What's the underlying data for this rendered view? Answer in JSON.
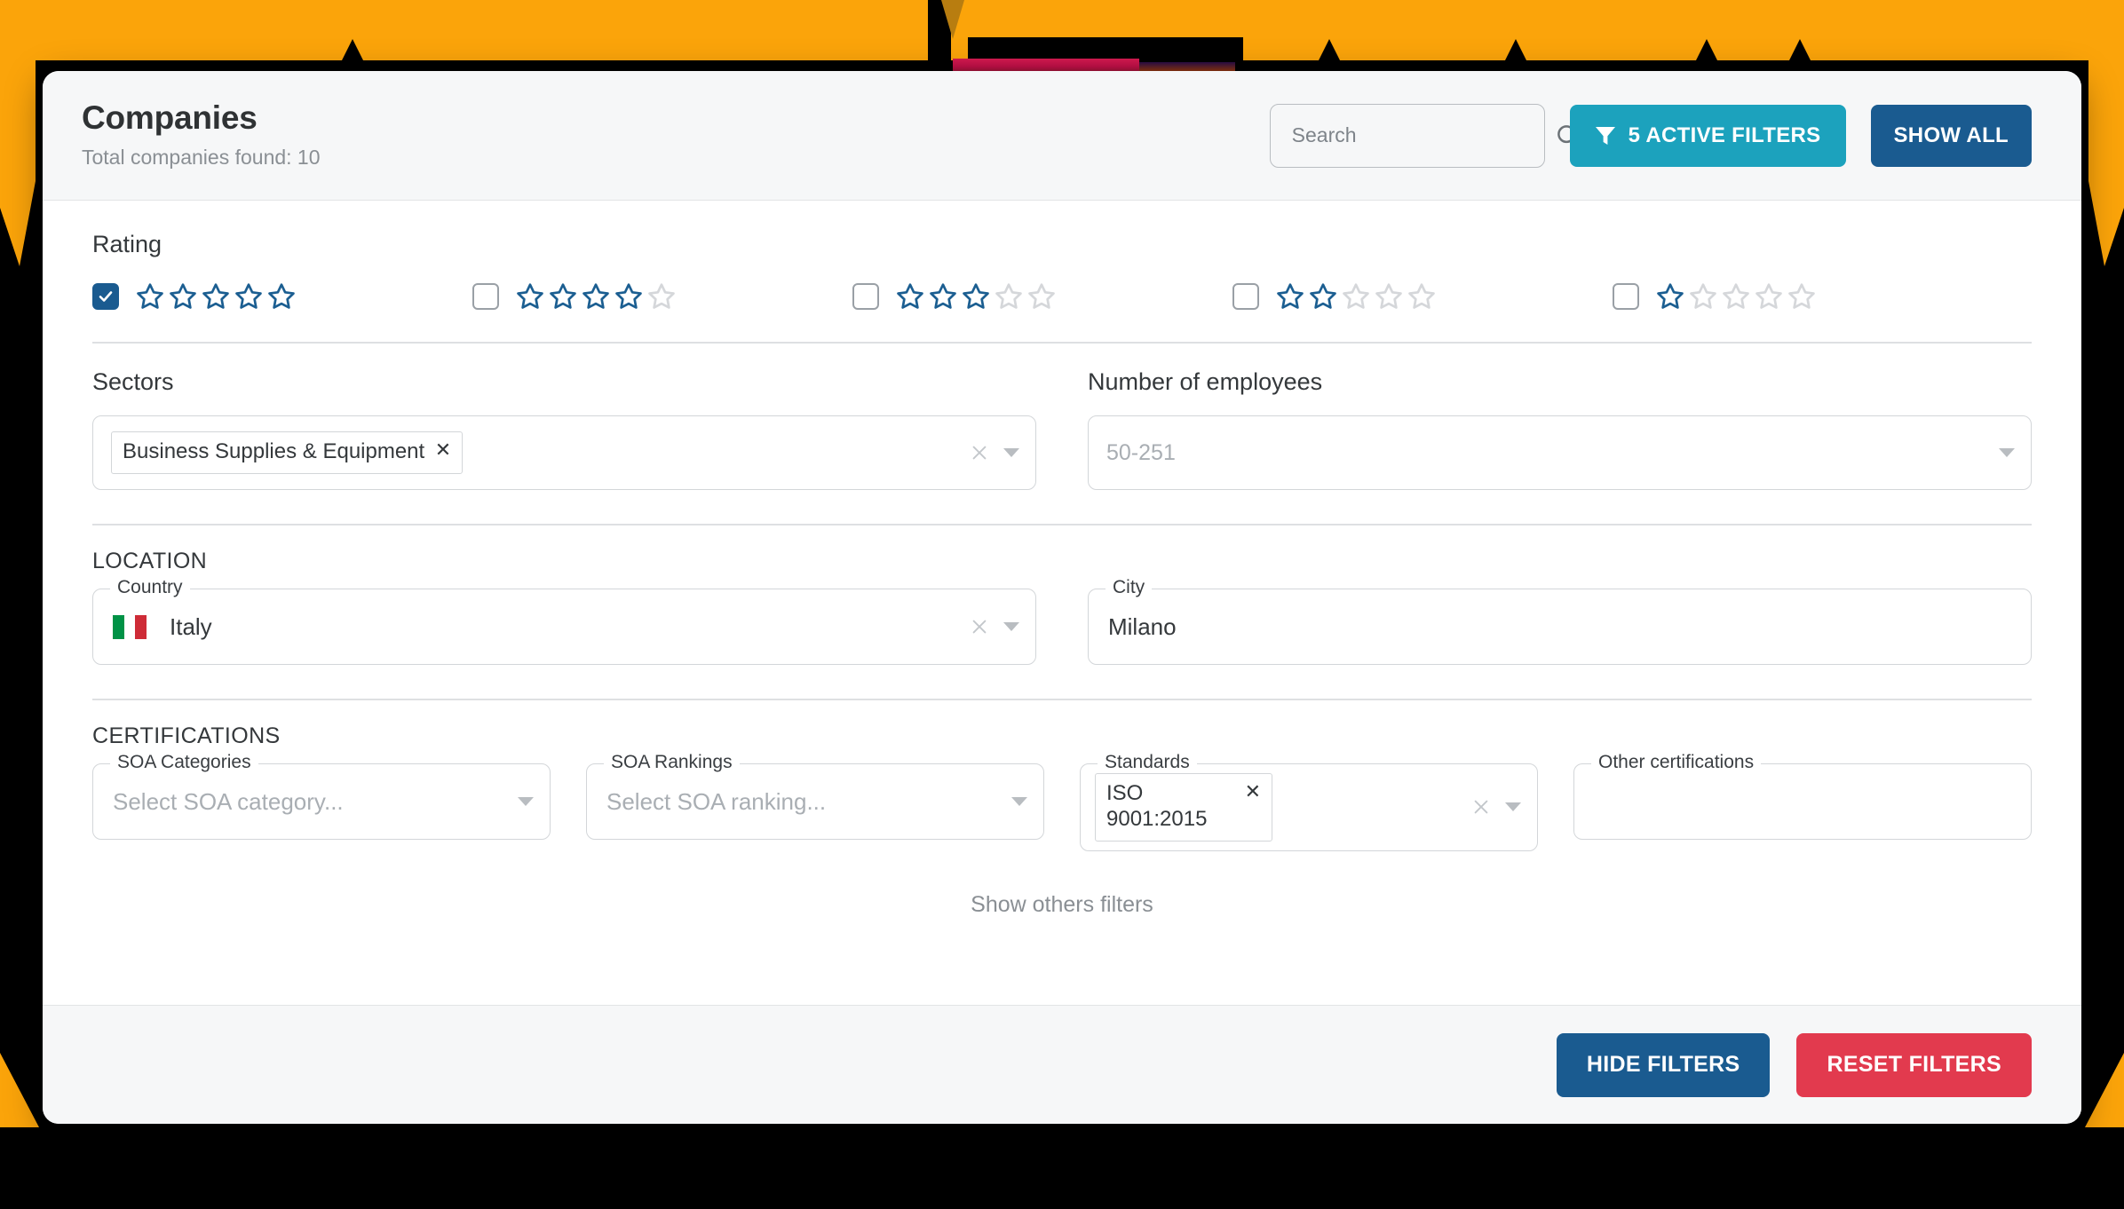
{
  "header": {
    "title": "Companies",
    "subtitle": "Total companies found: 10",
    "search": {
      "placeholder": "Search",
      "value": "",
      "icon": "search-icon"
    },
    "active_filters_button": {
      "label": "5 ACTIVE FILTERS",
      "icon": "funnel-icon",
      "color": "#1CA2BD"
    },
    "show_all_button": {
      "label": "SHOW ALL",
      "color": "#1A5B90"
    }
  },
  "rating": {
    "label": "Rating",
    "star_on_color": "#1B5E91",
    "star_off_color": "#D5D7DA",
    "options": [
      {
        "stars_filled": 5,
        "stars_total": 5,
        "checked": true
      },
      {
        "stars_filled": 4,
        "stars_total": 5,
        "checked": false
      },
      {
        "stars_filled": 3,
        "stars_total": 5,
        "checked": false
      },
      {
        "stars_filled": 2,
        "stars_total": 5,
        "checked": false
      },
      {
        "stars_filled": 1,
        "stars_total": 5,
        "checked": false
      }
    ]
  },
  "sectors": {
    "label": "Sectors",
    "chips": [
      {
        "text": "Business Supplies & Equipment",
        "remove_icon": "close-icon"
      }
    ],
    "clear_icon": "clear-icon",
    "dropdown_icon": "chevron-down-icon"
  },
  "employees": {
    "label": "Number of employees",
    "placeholder": "50-251",
    "value": "",
    "dropdown_icon": "chevron-down-icon"
  },
  "location": {
    "section_label": "LOCATION",
    "country": {
      "label": "Country",
      "value": "Italy",
      "flag": "flag-italy",
      "clear_icon": "clear-icon",
      "dropdown_icon": "chevron-down-icon"
    },
    "city": {
      "label": "City",
      "value": "Milano",
      "placeholder": ""
    }
  },
  "certifications": {
    "section_label": "CERTIFICATIONS",
    "soa_categories": {
      "label": "SOA Categories",
      "placeholder": "Select SOA category...",
      "dropdown_icon": "chevron-down-icon"
    },
    "soa_rankings": {
      "label": "SOA Rankings",
      "placeholder": "Select SOA ranking...",
      "dropdown_icon": "chevron-down-icon"
    },
    "standards": {
      "label": "Standards",
      "chips": [
        {
          "text": "ISO 9001:2015",
          "remove_icon": "close-icon"
        }
      ],
      "clear_icon": "clear-icon",
      "dropdown_icon": "chevron-down-icon"
    },
    "other_certifications": {
      "label": "Other certifications",
      "value": "",
      "placeholder": ""
    }
  },
  "show_others_filters": "Show others filters",
  "footer": {
    "hide_filters_button": {
      "label": "HIDE FILTERS",
      "color": "#1A5B90"
    },
    "reset_filters_button": {
      "label": "RESET FILTERS",
      "color": "#E23A4E"
    }
  },
  "background": {
    "accent_color": "#FBA40A"
  }
}
